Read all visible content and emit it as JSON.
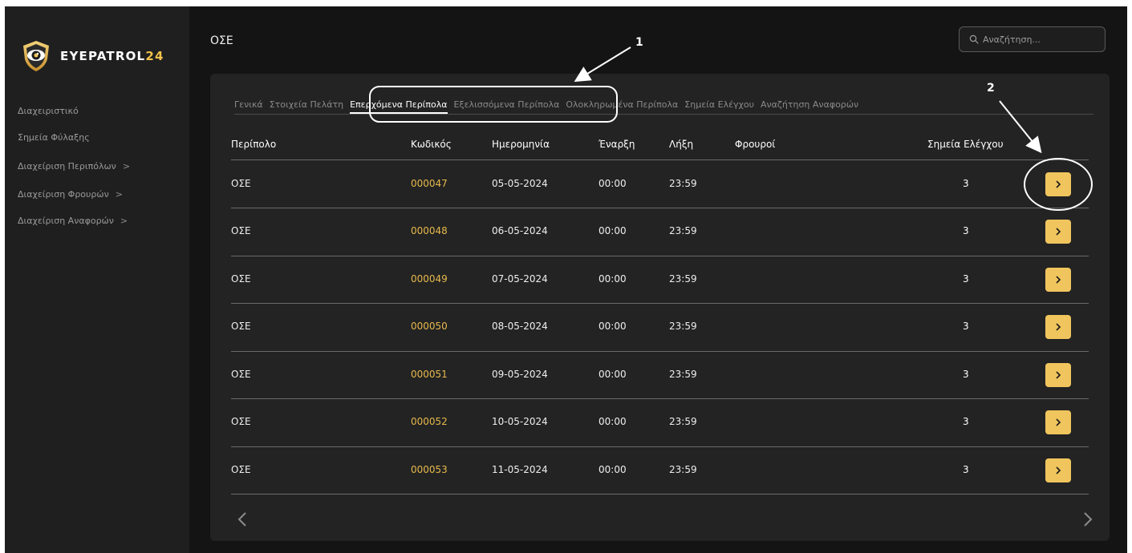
{
  "app": {
    "brand_main": "EYEPATROL",
    "brand_num": "24"
  },
  "sidebar": {
    "items": [
      {
        "label": "Διαχειριστικό",
        "chevron": false
      },
      {
        "label": "Σημεία Φύλαξης",
        "chevron": false
      },
      {
        "label": "Διαχείριση Περιπόλων",
        "chevron": true
      },
      {
        "label": "Διαχείριση Φρουρών",
        "chevron": true
      },
      {
        "label": "Διαχείριση Αναφορών",
        "chevron": true
      }
    ],
    "chevron_glyph": ">"
  },
  "header": {
    "title": "ΟΣΕ",
    "search_placeholder": "Αναζήτηση..."
  },
  "tabs": [
    {
      "label": "Γενικά",
      "active": false
    },
    {
      "label": "Στοιχεία Πελάτη",
      "active": false
    },
    {
      "label": "Επερχόμενα Περίπολα",
      "active": true
    },
    {
      "label": "Εξελισσόμενα Περίπολα",
      "active": false
    },
    {
      "label": "Ολοκληρωμένα Περίπολα",
      "active": false
    },
    {
      "label": "Σημεία Ελέγχου",
      "active": false
    },
    {
      "label": "Αναζήτηση Αναφορών",
      "active": false
    }
  ],
  "table": {
    "columns": [
      "Περίπολο",
      "Κωδικός",
      "Ημερομηνία",
      "Έναρξη",
      "Λήξη",
      "Φρουροί",
      "Σημεία Ελέγχου"
    ],
    "rows": [
      {
        "patrol": "ΟΣΕ",
        "code": "000047",
        "date": "05-05-2024",
        "start": "00:00",
        "end": "23:59",
        "guards": "",
        "checkpoints": "3"
      },
      {
        "patrol": "ΟΣΕ",
        "code": "000048",
        "date": "06-05-2024",
        "start": "00:00",
        "end": "23:59",
        "guards": "",
        "checkpoints": "3"
      },
      {
        "patrol": "ΟΣΕ",
        "code": "000049",
        "date": "07-05-2024",
        "start": "00:00",
        "end": "23:59",
        "guards": "",
        "checkpoints": "3"
      },
      {
        "patrol": "ΟΣΕ",
        "code": "000050",
        "date": "08-05-2024",
        "start": "00:00",
        "end": "23:59",
        "guards": "",
        "checkpoints": "3"
      },
      {
        "patrol": "ΟΣΕ",
        "code": "000051",
        "date": "09-05-2024",
        "start": "00:00",
        "end": "23:59",
        "guards": "",
        "checkpoints": "3"
      },
      {
        "patrol": "ΟΣΕ",
        "code": "000052",
        "date": "10-05-2024",
        "start": "00:00",
        "end": "23:59",
        "guards": "",
        "checkpoints": "3"
      },
      {
        "patrol": "ΟΣΕ",
        "code": "000053",
        "date": "11-05-2024",
        "start": "00:00",
        "end": "23:59",
        "guards": "",
        "checkpoints": "3"
      }
    ]
  },
  "annotations": {
    "label_1": "1",
    "label_2": "2"
  },
  "colors": {
    "accent": "#f0c55d",
    "code_text": "#e7b94c",
    "card_bg": "#232323",
    "sidebar_bg": "#1f1f1f",
    "page_bg": "#141414"
  },
  "icons": {
    "logo": "eye-shield-logo",
    "search": "search-icon",
    "row_action": "chevron-right-icon",
    "prev_page": "chevron-left-icon",
    "next_page": "chevron-right-icon"
  }
}
